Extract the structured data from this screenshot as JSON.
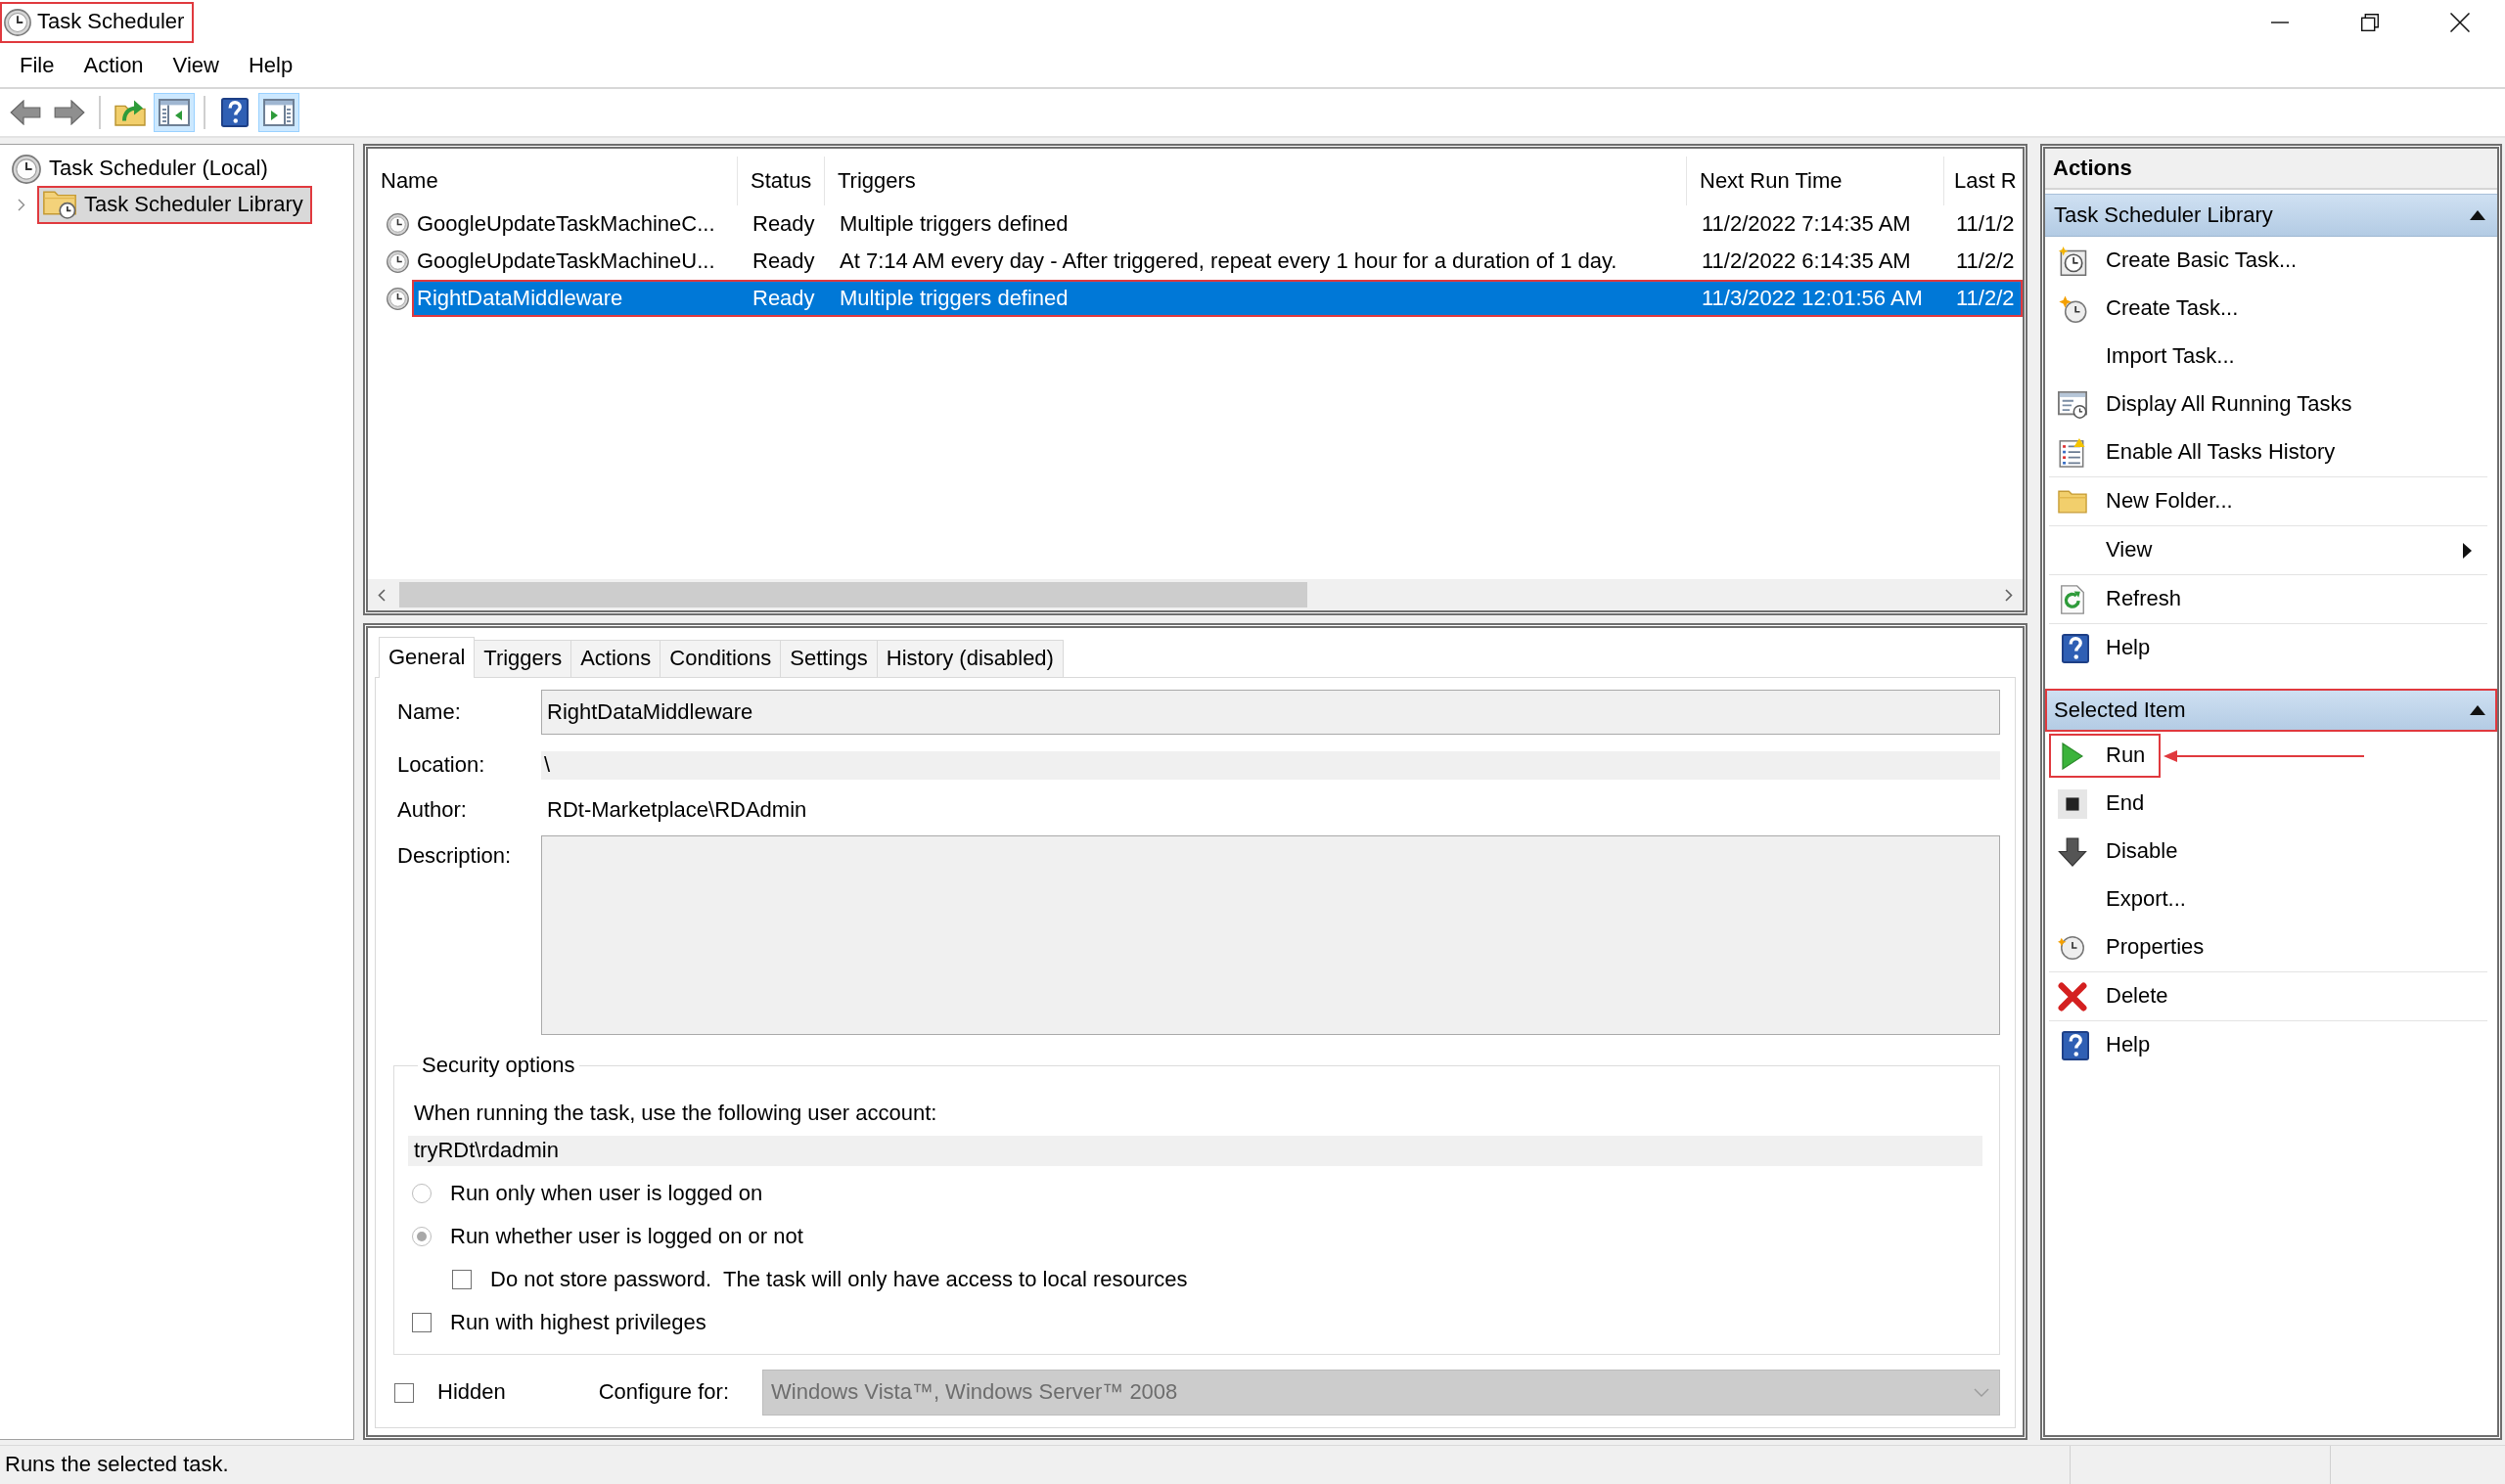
{
  "window": {
    "title": "Task Scheduler",
    "highlighted": true
  },
  "menu": [
    {
      "label": "File"
    },
    {
      "label": "Action"
    },
    {
      "label": "View"
    },
    {
      "label": "Help"
    }
  ],
  "toolbar": {
    "groups": [
      {
        "buttons": [
          {
            "kind": "back",
            "pressed": false
          },
          {
            "kind": "forward",
            "pressed": false
          }
        ]
      },
      {
        "buttons": [
          {
            "kind": "up",
            "pressed": false
          },
          {
            "kind": "tree",
            "pressed": true
          }
        ]
      },
      {
        "buttons": [
          {
            "kind": "help",
            "pressed": false
          },
          {
            "kind": "actions",
            "pressed": true
          }
        ]
      }
    ]
  },
  "tree": [
    {
      "label": "Task Scheduler (Local)",
      "kind": "scheduler",
      "selected": false,
      "highlighted": false,
      "children": [
        {
          "label": "Task Scheduler Library",
          "kind": "folder",
          "expanded": false,
          "selected": true,
          "highlighted": true
        }
      ]
    }
  ],
  "task_list": {
    "columns": [
      "Name",
      "Status",
      "Triggers",
      "Next Run Time",
      "Last R"
    ],
    "rows": [
      {
        "cells": [
          "GoogleUpdateTaskMachineC...",
          "Ready",
          "Multiple triggers defined",
          "11/2/2022 7:14:35 AM",
          "11/1/2"
        ],
        "selected": false,
        "highlighted": false
      },
      {
        "cells": [
          "GoogleUpdateTaskMachineU...",
          "Ready",
          "At 7:14 AM every day - After triggered, repeat every 1 hour for a duration of 1 day.",
          "11/2/2022 6:14:35 AM",
          "11/2/2"
        ],
        "selected": false,
        "highlighted": false
      },
      {
        "cells": [
          "RightDataMiddleware",
          "Ready",
          "Multiple triggers defined",
          "11/3/2022 12:01:56 AM",
          "11/2/2"
        ],
        "selected": true,
        "highlighted": true
      }
    ]
  },
  "detail": {
    "tabs": [
      {
        "label": "General",
        "selected": true
      },
      {
        "label": "Triggers",
        "selected": false
      },
      {
        "label": "Actions",
        "selected": false
      },
      {
        "label": "Conditions",
        "selected": false
      },
      {
        "label": "Settings",
        "selected": false
      },
      {
        "label": "History (disabled)",
        "selected": false
      }
    ],
    "general": {
      "name": {
        "label": "Name:",
        "value": "RightDataMiddleware"
      },
      "location": {
        "label": "Location:",
        "value": "\\"
      },
      "author": {
        "label": "Author:",
        "value": "RDt-Marketplace\\RDAdmin"
      },
      "description": {
        "label": "Description:"
      },
      "security": {
        "title": "Security options",
        "prompt": "When running the task, use the following user account:",
        "account": "tryRDt\\rdadmin",
        "options": [
          {
            "kind": "radio",
            "label": "Run only when user is logged on",
            "checked": false
          },
          {
            "kind": "radio",
            "label": "Run whether user is logged on or not",
            "checked": true,
            "children": [
              {
                "kind": "checkbox",
                "label": "Do not store password.  The task will only have access to local resources",
                "checked": false
              }
            ]
          },
          {
            "kind": "checkbox",
            "label": "Run with highest privileges",
            "checked": false
          }
        ]
      },
      "hidden": {
        "label": "Hidden",
        "checked": false
      },
      "configure_for": {
        "label": "Configure for:",
        "value": "Windows Vista™, Windows Server™ 2008",
        "disabled": true
      }
    }
  },
  "actions_pane": {
    "title": "Actions",
    "sections": [
      {
        "title": "Task Scheduler Library",
        "expanded": true,
        "highlighted": false,
        "groups": [
          {
            "items": [
              {
                "label": "Create Basic Task...",
                "kind": "wizard",
                "highlighted": false,
                "callout_arrow": false
              },
              {
                "label": "Create Task...",
                "kind": "create",
                "highlighted": false,
                "callout_arrow": false
              },
              {
                "label": "Import Task...",
                "kind": "import",
                "highlighted": false,
                "callout_arrow": false
              },
              {
                "label": "Display All Running Tasks",
                "kind": "running",
                "highlighted": false,
                "callout_arrow": false
              },
              {
                "label": "Enable All Tasks History",
                "kind": "history",
                "highlighted": false,
                "callout_arrow": false
              }
            ]
          },
          {
            "items": [
              {
                "label": "New Folder...",
                "kind": "folder",
                "highlighted": false,
                "callout_arrow": false
              }
            ]
          },
          {
            "items": [
              {
                "label": "View",
                "kind": "submenu",
                "highlighted": false,
                "callout_arrow": false
              }
            ]
          },
          {
            "items": [
              {
                "label": "Refresh",
                "kind": "refresh",
                "highlighted": false,
                "callout_arrow": false
              }
            ]
          },
          {
            "items": [
              {
                "label": "Help",
                "kind": "help",
                "highlighted": false,
                "callout_arrow": false
              }
            ]
          }
        ]
      },
      {
        "title": "Selected Item",
        "expanded": true,
        "highlighted": true,
        "groups": [
          {
            "items": [
              {
                "label": "Run",
                "kind": "run",
                "highlighted": true,
                "callout_arrow": true
              },
              {
                "label": "End",
                "kind": "end",
                "highlighted": false,
                "callout_arrow": false
              },
              {
                "label": "Disable",
                "kind": "disable",
                "highlighted": false,
                "callout_arrow": false
              },
              {
                "label": "Export...",
                "kind": "export",
                "highlighted": false,
                "callout_arrow": false
              },
              {
                "label": "Properties",
                "kind": "properties",
                "highlighted": false,
                "callout_arrow": false
              }
            ]
          },
          {
            "items": [
              {
                "label": "Delete",
                "kind": "delete",
                "highlighted": false,
                "callout_arrow": false
              }
            ]
          },
          {
            "items": [
              {
                "label": "Help",
                "kind": "help",
                "highlighted": false,
                "callout_arrow": false
              }
            ]
          }
        ]
      }
    ]
  },
  "status_bar": {
    "text": "Runs the selected task."
  }
}
